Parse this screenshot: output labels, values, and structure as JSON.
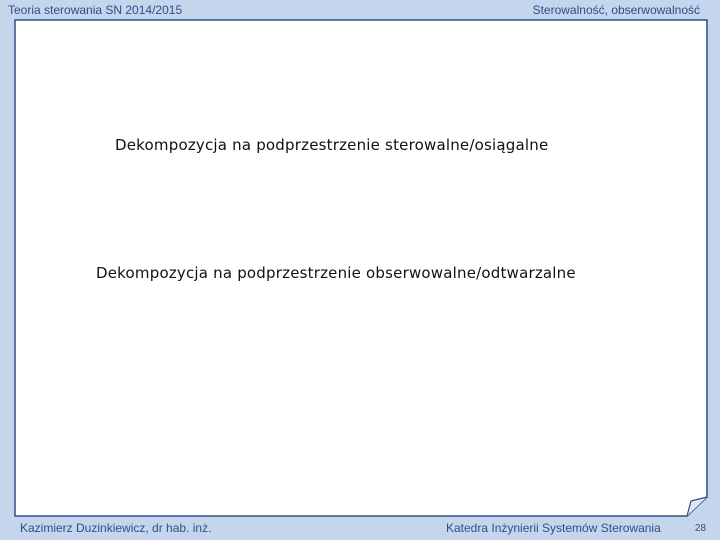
{
  "header": {
    "left": "Teoria sterowania SN 2014/2015",
    "right": "Sterowalność, obserwowalność"
  },
  "content": {
    "line1": "Dekompozycja na podprzestrzenie sterowalne/osiągalne",
    "line2": "Dekompozycja na podprzestrzenie obserwowalne/odtwarzalne"
  },
  "footer": {
    "author": "Kazimierz Duzinkiewicz, dr hab. inż.",
    "department": "Katedra Inżynierii Systemów Sterowania",
    "page_number": "28"
  },
  "colors": {
    "background": "#c5d5ec",
    "text_accent": "#2f4f86",
    "paper": "#ffffff"
  }
}
